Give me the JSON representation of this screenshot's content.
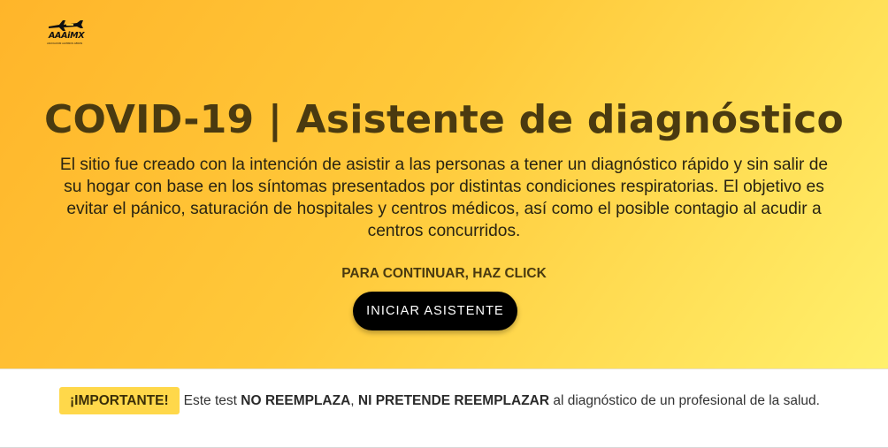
{
  "brand": {
    "logo_text": "AAAiMX",
    "logo_tagline": "ASOCIACIÓN ALUMNOS AERONÁUTICA",
    "logo_icon": "airplane-icon"
  },
  "hero": {
    "title": "COVID-19 | Asistente de diagnóstico",
    "description": "El sitio fue creado con la intención de asistir a las personas a tener un diagnóstico rápido y sin salir de su hogar con base en los síntomas presentados por distintas condiciones respiratorias. El objetivo es evitar el pánico, saturación de hospitales y centros médicos, así como el posible contagio al acudir a centros concurridos.",
    "continue_label": "PARA CONTINUAR, HAZ CLICK",
    "start_button_label": "INICIAR ASISTENTE"
  },
  "notice": {
    "badge": "¡IMPORTANTE!",
    "text_before": "Este test",
    "bold_1": "NO REEMPLAZA",
    "separator": ",",
    "bold_2": "NI PRETENDE REEMPLAZAR",
    "text_after": "al diagnóstico de un profesional de la salud."
  },
  "colors": {
    "hero_gradient_start": "#ffb52a",
    "hero_gradient_end": "#fff06c",
    "title_color": "#4a3a10",
    "button_bg": "#000000",
    "badge_bg": "#ffd84a"
  }
}
